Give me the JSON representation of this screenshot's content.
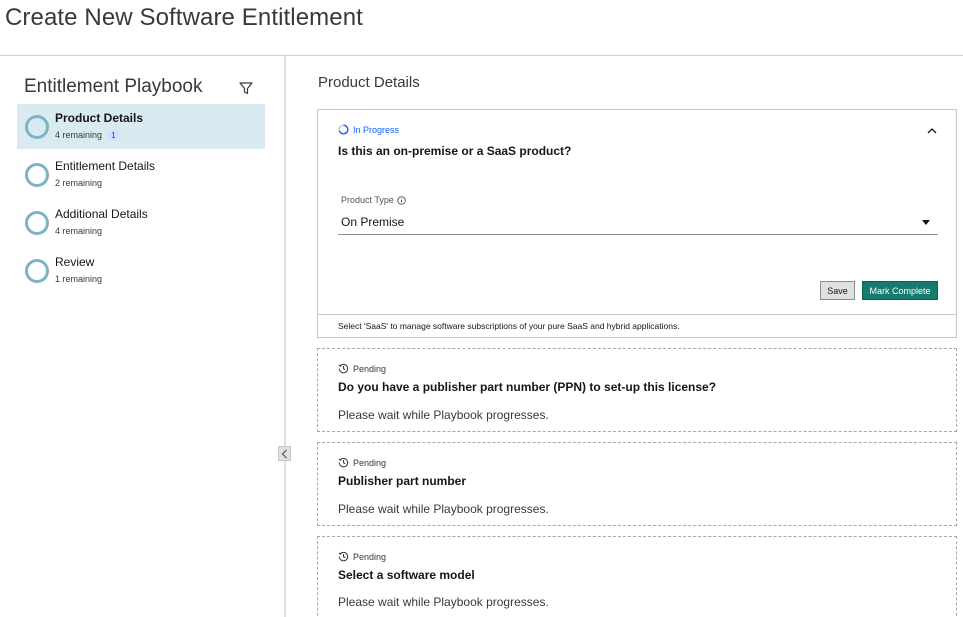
{
  "page": {
    "title": "Create New Software Entitlement"
  },
  "sidebar": {
    "title": "Entitlement Playbook",
    "filter_icon": "filter-icon",
    "items": [
      {
        "label": "Product Details",
        "sub": "4 remaining",
        "badge": "1",
        "active": true
      },
      {
        "label": "Entitlement Details",
        "sub": "2 remaining"
      },
      {
        "label": "Additional Details",
        "sub": "4 remaining"
      },
      {
        "label": "Review",
        "sub": "1 remaining"
      }
    ]
  },
  "main": {
    "section_title": "Product Details",
    "active_card": {
      "status": "In Progress",
      "question": "Is this an on-premise or a SaaS product?",
      "field_label": "Product Type",
      "field_value": "On Premise",
      "save_label": "Save",
      "complete_label": "Mark Complete",
      "hint": "Select 'SaaS' to manage software subscriptions of your pure SaaS and hybrid applications."
    },
    "pending_cards": [
      {
        "status": "Pending",
        "question": "Do you have a publisher part number (PPN) to set-up this license?",
        "message": "Please wait while Playbook progresses."
      },
      {
        "status": "Pending",
        "question": "Publisher part number",
        "message": "Please wait while Playbook progresses."
      },
      {
        "status": "Pending",
        "question": "Select a software model",
        "message": "Please wait while Playbook progresses."
      }
    ]
  },
  "colors": {
    "accent": "#167a6e",
    "active_bg": "#d9ebf0",
    "ring": "#7fb3c4",
    "in_progress": "#0f62fe"
  }
}
